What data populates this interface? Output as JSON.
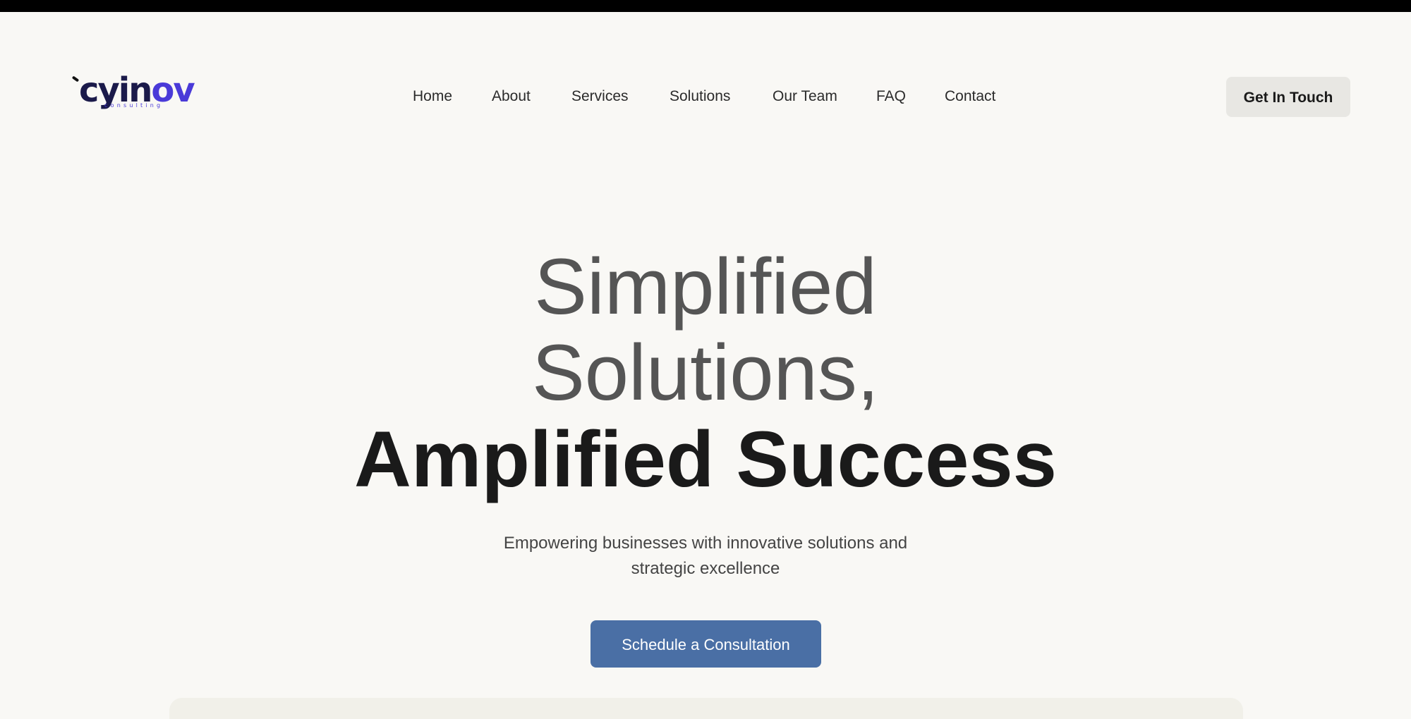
{
  "brand": {
    "name_main": "cyin",
    "name_accent": "ov",
    "tagline": "consulting",
    "colors": {
      "navy": "#1b1a4a",
      "accent": "#4a3ad8"
    }
  },
  "nav": {
    "items": [
      {
        "label": "Home"
      },
      {
        "label": "About"
      },
      {
        "label": "Services"
      },
      {
        "label": "Solutions"
      },
      {
        "label": "Our Team"
      },
      {
        "label": "FAQ"
      },
      {
        "label": "Contact"
      }
    ],
    "cta_label": "Get In Touch"
  },
  "hero": {
    "line1": "Simplified",
    "line2": "Solutions,",
    "line3": "Amplified Success",
    "subtitle_line1": "Empowering businesses with innovative solutions and",
    "subtitle_line2": "strategic excellence",
    "cta_label": "Schedule a Consultation"
  },
  "theme": {
    "background": "#f9f8f5",
    "primary_button": "#4a6fa5",
    "secondary_button": "#e8e7e3",
    "heading_light": "#555555",
    "heading_dark": "#1a1a1a"
  }
}
